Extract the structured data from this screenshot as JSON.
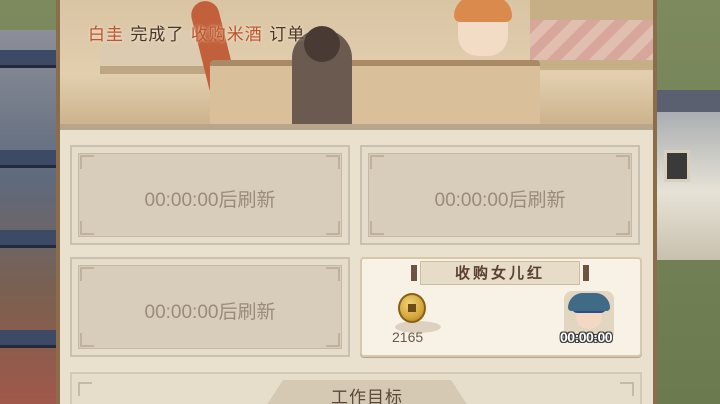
{
  "notice": {
    "customer": "白圭",
    "action": "完成了",
    "order": "收购米酒",
    "suffix": "订单"
  },
  "slots": [
    {
      "timer": "00:00:00后刷新"
    },
    {
      "timer": "00:00:00后刷新"
    },
    {
      "timer": "00:00:00后刷新"
    }
  ],
  "active_order": {
    "title": "收购女儿红",
    "reward_value": "2165",
    "reward_icon": "copper-coin-icon",
    "customer_timer": "00:00:00"
  },
  "footer": {
    "goal_label": "工作目标"
  }
}
